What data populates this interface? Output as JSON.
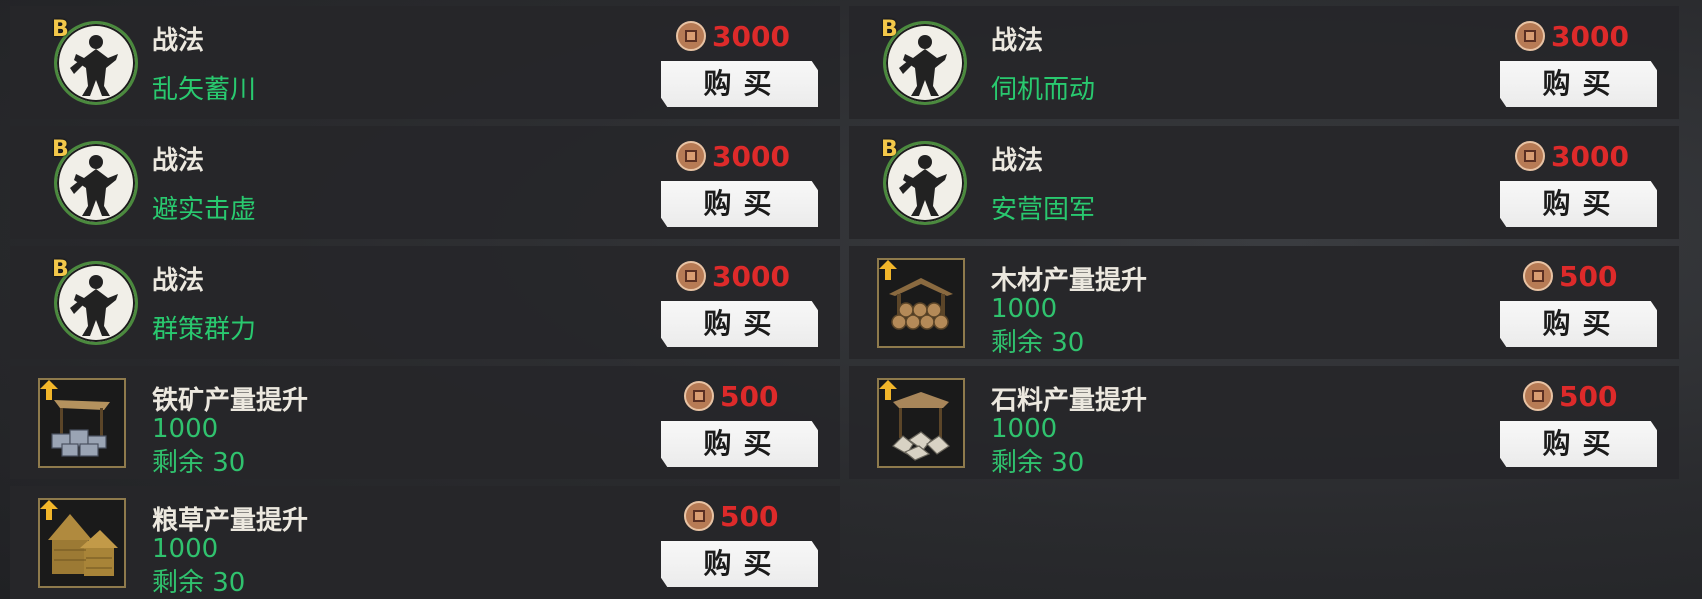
{
  "currency_icon": "copper-coin-icon",
  "buy_label": "购买",
  "colors": {
    "price": "#dd2a2a",
    "green_text": "#29c96f",
    "button_bg": "#f2f2f2"
  },
  "items": [
    {
      "type": "skill",
      "grade": "B",
      "title": "战法",
      "name": "乱矢蓄川",
      "price": "3000"
    },
    {
      "type": "skill",
      "grade": "B",
      "title": "战法",
      "name": "伺机而动",
      "price": "3000"
    },
    {
      "type": "skill",
      "grade": "B",
      "title": "战法",
      "name": "避实击虚",
      "price": "3000"
    },
    {
      "type": "skill",
      "grade": "B",
      "title": "战法",
      "name": "安营固军",
      "price": "3000"
    },
    {
      "type": "skill",
      "grade": "B",
      "title": "战法",
      "name": "群策群力",
      "price": "3000"
    },
    {
      "type": "boost",
      "icon": "wood-pile-icon",
      "title": "木材产量提升",
      "amount": "1000",
      "remaining": "剩余 30",
      "price": "500"
    },
    {
      "type": "boost",
      "icon": "iron-ore-icon",
      "title": "铁矿产量提升",
      "amount": "1000",
      "remaining": "剩余 30",
      "price": "500"
    },
    {
      "type": "boost",
      "icon": "stone-quarry-icon",
      "title": "石料产量提升",
      "amount": "1000",
      "remaining": "剩余 30",
      "price": "500"
    },
    {
      "type": "boost",
      "icon": "grain-hut-icon",
      "title": "粮草产量提升",
      "amount": "1000",
      "remaining": "剩余 30",
      "price": "500"
    }
  ]
}
